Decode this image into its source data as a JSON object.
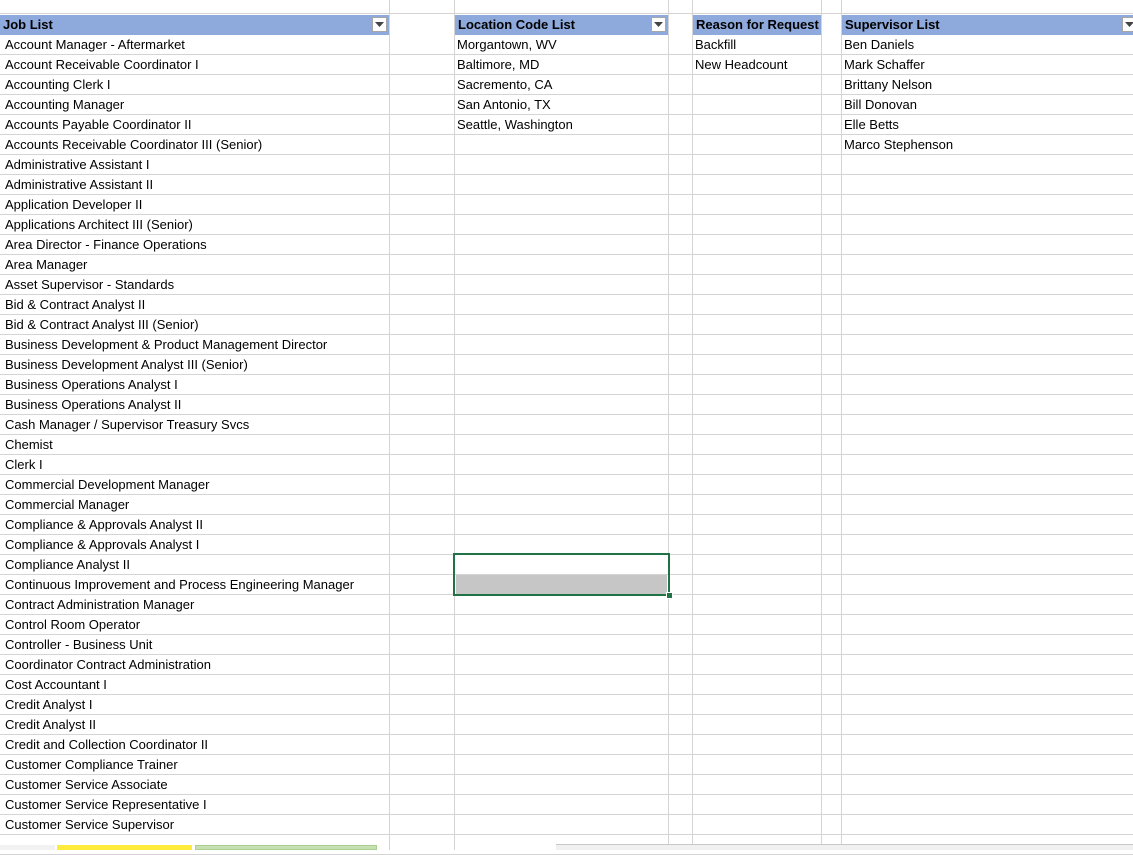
{
  "headers": {
    "job": "Job List",
    "location": "Location Code List",
    "reason": "Reason for Request",
    "supervisor": "Supervisor List"
  },
  "icons": {
    "filter": "dropdown-arrow-icon"
  },
  "colors": {
    "header_fill": "#8ea9db",
    "selection": "#217346",
    "gridline": "#d4d4d4",
    "selected_cell_fill": "#c6c6c6"
  },
  "jobs": [
    "Account Manager - Aftermarket",
    "Account Receivable Coordinator I",
    "Accounting Clerk I",
    "Accounting Manager",
    "Accounts Payable Coordinator II",
    "Accounts Receivable Coordinator III (Senior)",
    "Administrative Assistant I",
    "Administrative Assistant II",
    "Application Developer II",
    "Applications Architect III (Senior)",
    "Area Director - Finance Operations",
    "Area Manager",
    "Asset Supervisor - Standards",
    "Bid & Contract Analyst II",
    "Bid & Contract Analyst III (Senior)",
    "Business Development & Product Management Director",
    "Business Development Analyst III (Senior)",
    "Business Operations Analyst I",
    "Business Operations Analyst II",
    "Cash Manager / Supervisor Treasury Svcs",
    "Chemist",
    "Clerk I",
    "Commercial Development Manager",
    "Commercial Manager",
    "Compliance & Approvals Analyst II",
    "Compliance &  Approvals Analyst I",
    "Compliance Analyst II",
    "Continuous Improvement and Process Engineering Manager",
    "Contract Administration Manager",
    "Control Room Operator",
    "Controller - Business Unit",
    "Coordinator Contract Administration",
    "Cost Accountant I",
    "Credit Analyst I",
    "Credit Analyst II",
    "Credit and Collection Coordinator II",
    "Customer Compliance Trainer",
    "Customer Service Associate",
    "Customer Service Representative I",
    "Customer Service Supervisor"
  ],
  "locations": [
    "Morgantown, WV",
    "Baltimore, MD",
    "Sacremento, CA",
    "San Antonio, TX",
    "Seattle, Washington"
  ],
  "reasons": [
    "Backfill",
    "New Headcount"
  ],
  "supervisors": [
    "Ben Daniels",
    "Mark Schaffer",
    "Brittany Nelson",
    "Bill Donovan",
    "Elle Betts",
    "Marco Stephenson"
  ],
  "selection": {
    "column": "location",
    "rows": [
      26,
      27
    ]
  }
}
